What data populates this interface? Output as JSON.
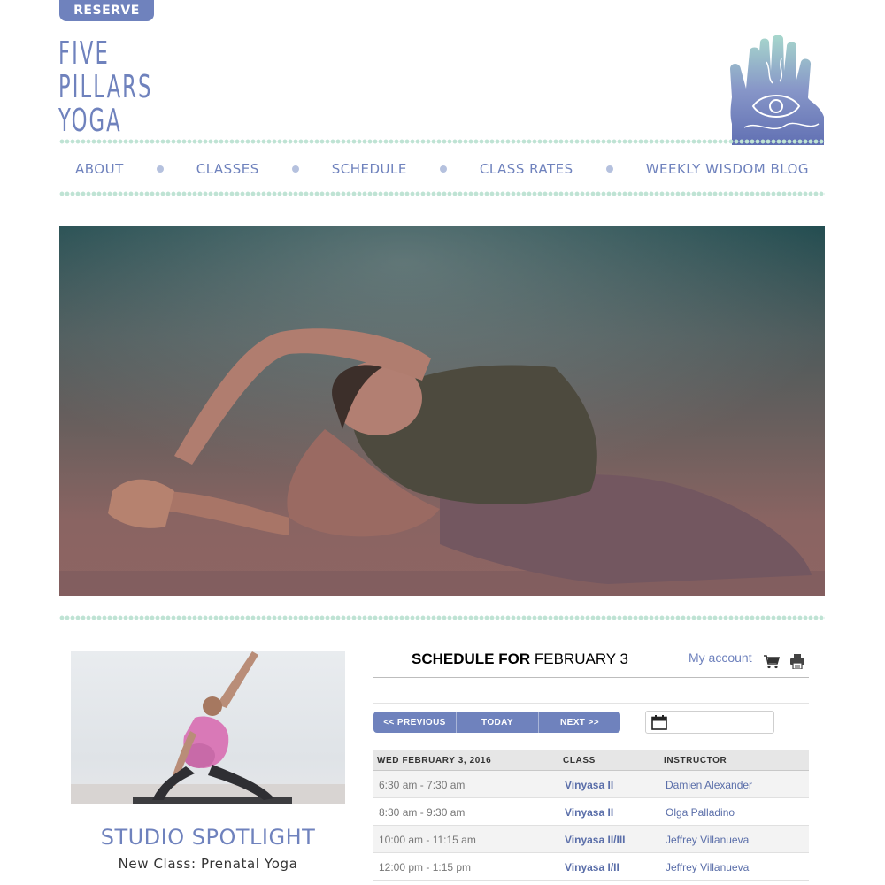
{
  "header": {
    "reserve_label": "RESERVE",
    "logo_lines": [
      "FIVE",
      "PILLARS",
      "YOGA"
    ]
  },
  "nav": {
    "items": [
      "ABOUT",
      "CLASSES",
      "SCHEDULE",
      "CLASS RATES",
      "WEEKLY WISDOM BLOG"
    ]
  },
  "spotlight": {
    "title": "STUDIO SPOTLIGHT",
    "subtitle": "New Class: Prenatal Yoga"
  },
  "schedule": {
    "title_prefix": "SCHEDULE FOR",
    "title_date": "FEBRUARY 3",
    "my_account": "My account",
    "buttons": {
      "previous": "<< PREVIOUS",
      "today": "TODAY",
      "next": "NEXT >>"
    },
    "date_value": "",
    "columns": [
      "WED FEBRUARY 3, 2016",
      "CLASS",
      "INSTRUCTOR"
    ],
    "rows": [
      {
        "time": "6:30 am - 7:30 am",
        "class": "Vinyasa II",
        "instructor": "Damien Alexander"
      },
      {
        "time": "8:30 am - 9:30 am",
        "class": "Vinyasa II",
        "instructor": "Olga Palladino"
      },
      {
        "time": "10:00 am - 11:15 am",
        "class": "Vinyasa II/III",
        "instructor": "Jeffrey Villanueva"
      },
      {
        "time": "12:00 pm - 1:15 pm",
        "class": "Vinyasa I/II",
        "instructor": "Jeffrey Villanueva"
      }
    ]
  },
  "colors": {
    "brand": "#6f82bd",
    "accent_dots": "#bfe3d4"
  }
}
